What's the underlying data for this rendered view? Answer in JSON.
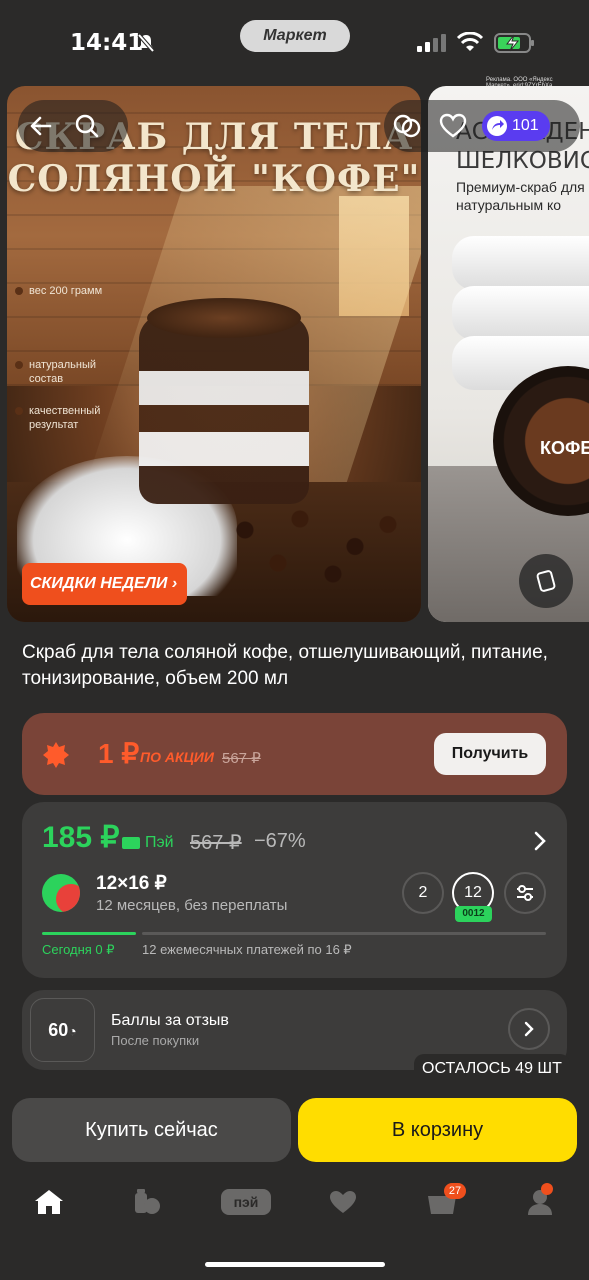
{
  "status_bar": {
    "time": "14:41",
    "app_pill": "Маркет",
    "ad_note": "Реклама. ООО «Яндекс Маркет». erid:9ZYrEbXa"
  },
  "gallery": {
    "card1": {
      "title": "СКРАБ ДЛЯ ТЕЛА СОЛЯНОЙ \"КОФЕ\"",
      "features": [
        "вес 200 грамм",
        "натуральный состав",
        "качественный результат"
      ],
      "promo_badge": "СКИДКИ НЕДЕЛИ ›"
    },
    "card2": {
      "title": "АСЛАЖДЕНИЕ ШЕЛКОВИСТОЙ",
      "subtitle": "Премиум-скраб для с натуральным ко",
      "tin_label": "КОФЕ"
    },
    "coins": "101"
  },
  "product": {
    "title": "Скраб для тела соляной кофе, отшелушивающий, питание, тонизирование, объем 200 мл"
  },
  "promo": {
    "price": "1 ₽",
    "label": "ПО АКЦИИ",
    "old_price": "567 ₽",
    "button": "Получить"
  },
  "price_card": {
    "price": "185 ₽",
    "pay_label": "Пэй",
    "old_price": "567 ₽",
    "discount": "−67%",
    "installment": "12×16 ₽",
    "installment_sub": "12 месяцев, без переплаты",
    "options": [
      "2",
      "12"
    ],
    "selected_tag": "0012",
    "today": "Сегодня 0 ₽",
    "payments": "12 ежемесячных платежей по 16 ₽"
  },
  "review": {
    "points": "60",
    "title": "Баллы за отзыв",
    "subtitle": "После покупки"
  },
  "stock_badge": "ОСТАЛОСЬ 49 ШТ",
  "actions": {
    "buy_now": "Купить сейчас",
    "add_to_cart": "В корзину"
  },
  "tabbar": {
    "pay_label": "пэй",
    "cart_count": "27"
  },
  "colors": {
    "accent_green": "#2cd35c",
    "accent_yellow": "#ffdd00",
    "promo_orange": "#ef4f1d"
  }
}
